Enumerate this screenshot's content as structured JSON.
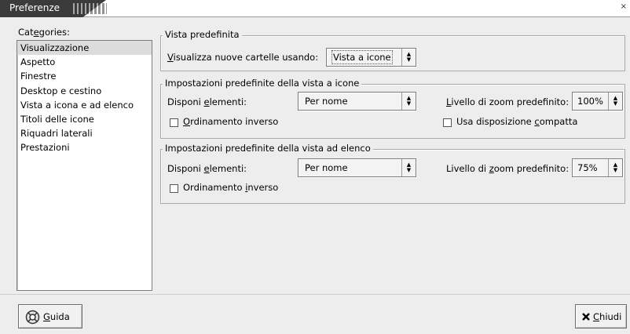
{
  "window": {
    "title": "Preferenze",
    "close_glyph": "×"
  },
  "categories": {
    "label_prefix": "Cat",
    "label_mnemonic": "e",
    "label_suffix": "gories:",
    "items": [
      "Visualizzazione",
      "Aspetto",
      "Finestre",
      "Desktop e cestino",
      "Vista a icona e ad elenco",
      "Titoli delle icone",
      "Riquadri laterali",
      "Prestazioni"
    ],
    "selected_index": 0
  },
  "default_view": {
    "legend": "Vista predefinita",
    "label_mnemonic": "V",
    "label_rest": "isualizza nuove cartelle usando:",
    "value": "Vista a icone"
  },
  "icon_view": {
    "legend": "Impostazioni predefinite della vista a icone",
    "arrange_prefix": "Disponi ",
    "arrange_mnemonic": "e",
    "arrange_suffix": "lementi:",
    "arrange_value": "Per nome",
    "zoom_mnemonic": "L",
    "zoom_rest": "ivello di zoom predefinito:",
    "zoom_value": "100%",
    "reverse_mnemonic": "O",
    "reverse_rest": "rdinamento inverso",
    "compact_prefix": "Usa disposizione ",
    "compact_mnemonic": "c",
    "compact_suffix": "ompatta",
    "reverse_checked": false,
    "compact_checked": false
  },
  "list_view": {
    "legend": "Impostazioni predefinite della vista ad elenco",
    "arrange_prefix": "Disponi ",
    "arrange_mnemonic": "e",
    "arrange_suffix": "lementi:",
    "arrange_value": "Per nome",
    "zoom_prefix": "Livello di ",
    "zoom_mnemonic": "z",
    "zoom_suffix": "oom predefinito:",
    "zoom_value": "75%",
    "reverse_prefix": "Ordinamento ",
    "reverse_mnemonic": "i",
    "reverse_suffix": "nverso",
    "reverse_checked": false
  },
  "buttons": {
    "help_mnemonic": "G",
    "help_rest": "uida",
    "help_icon": "help-lifebuoy-icon",
    "close_mnemonic": "C",
    "close_rest": "hiudi",
    "close_icon": "close-x-icon"
  },
  "colors": {
    "window_bg": "#ededed",
    "title_bg": "#3b3b3b",
    "selected_row": "#dcdcdc"
  }
}
